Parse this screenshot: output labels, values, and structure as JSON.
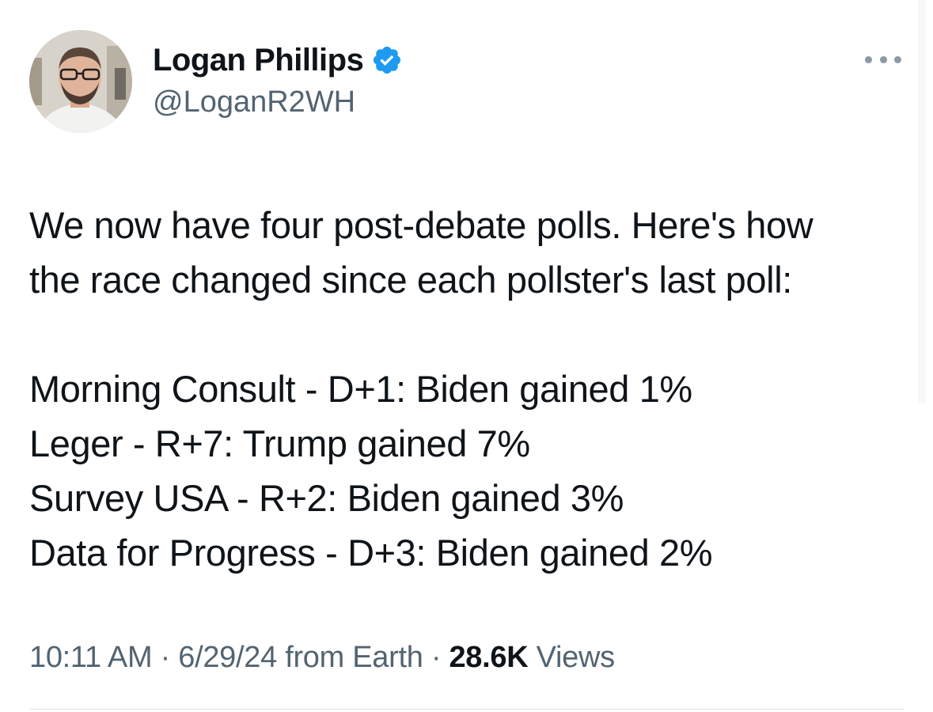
{
  "author": {
    "display_name": "Logan Phillips",
    "handle": "@LoganR2WH",
    "verified": true
  },
  "tweet": {
    "lines": [
      "We now have four post-debate polls. Here's how",
      "the race changed since each pollster's last poll:",
      "Morning Consult - D+1: Biden gained 1%",
      "Leger - R+7: Trump gained 7%",
      "Survey USA - R+2: Biden gained 3%",
      "Data for Progress - D+3: Biden gained 2%"
    ]
  },
  "meta": {
    "time": "10:11 AM",
    "separator": "·",
    "date": "6/29/24",
    "source": "from Earth",
    "views_count": "28.6K",
    "views_label": "Views"
  },
  "colors": {
    "text": "#0f1419",
    "secondary": "#536471",
    "verified_blue": "#1d9bf0"
  },
  "icons": {
    "verified": "verified-badge-icon",
    "more": "more-options-icon"
  }
}
